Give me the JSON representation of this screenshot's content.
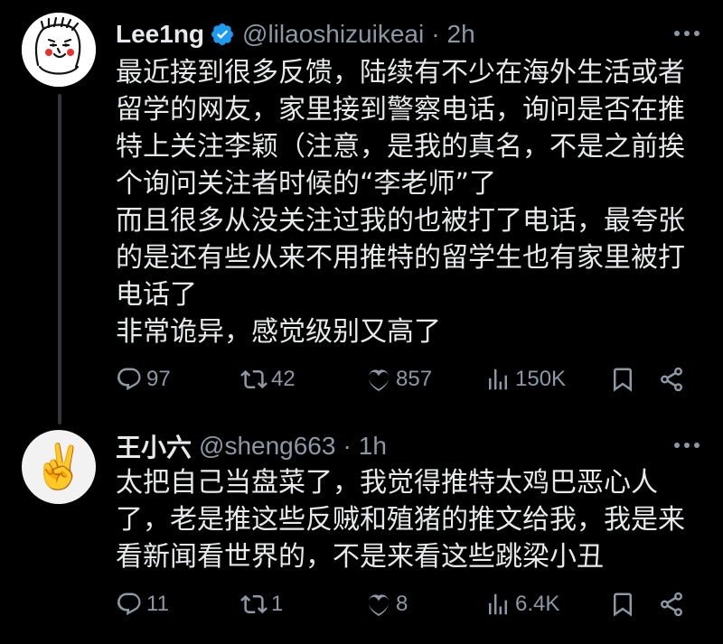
{
  "tweets": [
    {
      "name": "Lee1ng",
      "handle": "@lilaoshizuikeai",
      "dot": "·",
      "time": "2h",
      "verified": true,
      "lines": [
        "最近接到很多反馈，陆续有不少在海外生活或者",
        "留学的网友，家里接到警察电话，询问是否在推",
        "特上关注李颖（注意，是我的真名，不是之前挨",
        "个询问关注者时候的“李老师”了",
        "而且很多从没关注过我的也被打了电话，最夸张",
        "的是还有些从来不用推特的留学生也有家里被打",
        "电话了",
        "非常诡异，感觉级别又高了"
      ],
      "replies": "97",
      "retweets": "42",
      "likes": "857",
      "views": "150K"
    },
    {
      "name": "王小六",
      "handle": "@sheng663",
      "dot": "·",
      "time": "1h",
      "avatar_emoji": "✌️",
      "lines": [
        "太把自己当盘菜了，我觉得推特太鸡巴恶心人",
        "了，老是推这些反贼和殖猪的推文给我，我是来",
        "看新闻看世界的，不是来看这些跳梁小丑"
      ],
      "replies": "11",
      "retweets": "1",
      "likes": "8",
      "views": "6.4K"
    }
  ],
  "colors": {
    "background": "#000000",
    "text": "#e7e9ea",
    "secondary": "#8b98a5",
    "verified": "#1d9bf0",
    "thread_line": "#333639"
  }
}
